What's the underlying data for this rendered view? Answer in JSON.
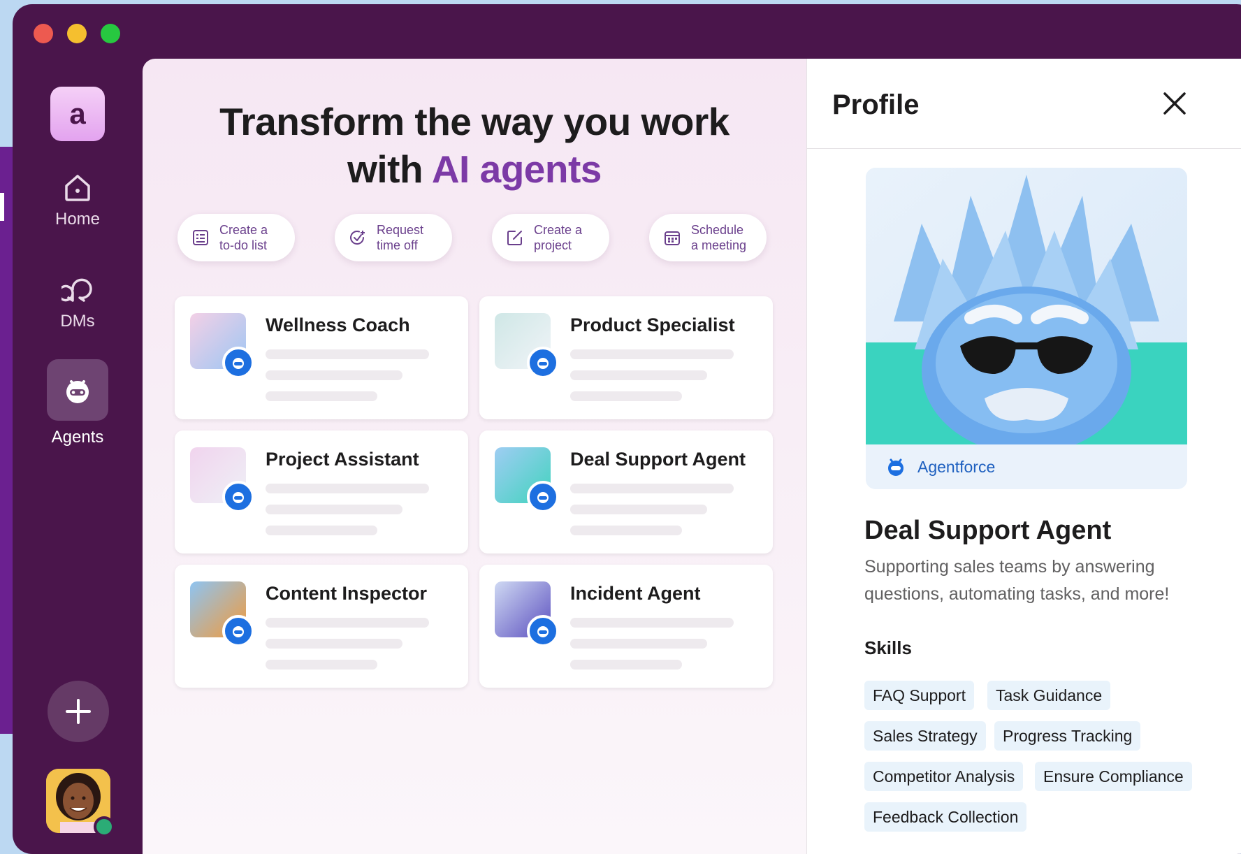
{
  "sidebar": {
    "workspace_initial": "a",
    "items": [
      {
        "label": "Home",
        "icon": "home-icon"
      },
      {
        "label": "DMs",
        "icon": "dms-icon"
      },
      {
        "label": "Agents",
        "icon": "agent-icon",
        "active": true
      }
    ],
    "add_icon": "plus-icon"
  },
  "hero": {
    "title_line1": "Transform the way you work",
    "title_with": "with ",
    "title_accent": "AI agents"
  },
  "quick_actions": [
    {
      "label": "Create a to-do list",
      "icon": "checklist-icon"
    },
    {
      "label": "Request time off",
      "icon": "clock-check-icon"
    },
    {
      "label": "Create a project",
      "icon": "edit-square-icon"
    },
    {
      "label": "Schedule a meeting",
      "icon": "calendar-icon"
    }
  ],
  "agents": [
    {
      "name": "Wellness Coach"
    },
    {
      "name": "Product Specialist"
    },
    {
      "name": "Project Assistant"
    },
    {
      "name": "Deal Support Agent"
    },
    {
      "name": "Content Inspector"
    },
    {
      "name": "Incident Agent"
    }
  ],
  "profile": {
    "title": "Profile",
    "brand": "Agentforce",
    "agent_name": "Deal Support Agent",
    "description": "Supporting sales teams by answering questions, automating tasks, and more!",
    "skills_title": "Skills",
    "skills": [
      "FAQ Support",
      "Task Guidance",
      "Sales Strategy",
      "Progress Tracking",
      "Competitor Analysis",
      "Ensure Compliance",
      "Feedback Collection"
    ]
  },
  "colors": {
    "sidebar_bg": "#4a154b",
    "accent": "#7c3aa6",
    "badge_blue": "#1d6fe0",
    "chip_bg": "#e9f3fb",
    "brand_text": "#1d5fbf"
  }
}
